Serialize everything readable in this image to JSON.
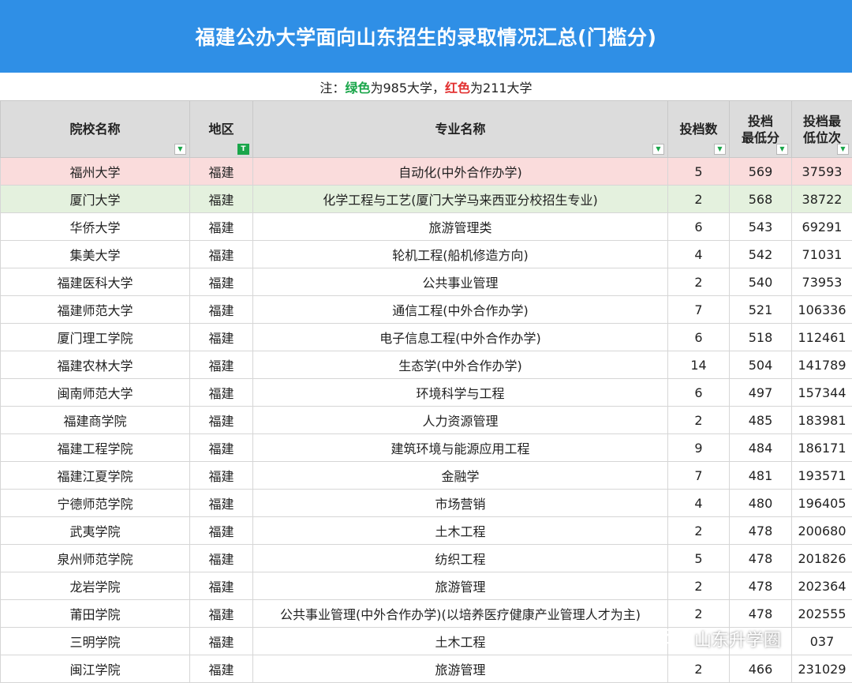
{
  "title": "福建公办大学面向山东招生的录取情况汇总(门槛分)",
  "note": {
    "prefix": "注：",
    "green_word": "绿色",
    "green_rest": "为985大学，",
    "red_word": "红色",
    "red_rest": "为211大学"
  },
  "headers": {
    "school": "院校名称",
    "region": "地区",
    "major": "专业名称",
    "count": "投档数",
    "min_score_l1": "投档",
    "min_score_l2": "最低分",
    "min_rank_l1": "投档最",
    "min_rank_l2": "低位次"
  },
  "colors": {
    "title_bg": "#2f8fe6",
    "green": "#1aa64a",
    "red": "#e23030",
    "row_985": "#fadcdc",
    "row_211": "#e4f1de"
  },
  "rows": [
    {
      "school": "福州大学",
      "region": "福建",
      "major": "自动化(中外合作办学)",
      "count": "5",
      "score": "569",
      "rank": "37593",
      "hl": "pink"
    },
    {
      "school": "厦门大学",
      "region": "福建",
      "major": "化学工程与工艺(厦门大学马来西亚分校招生专业)",
      "count": "2",
      "score": "568",
      "rank": "38722",
      "hl": "greenrow"
    },
    {
      "school": "华侨大学",
      "region": "福建",
      "major": "旅游管理类",
      "count": "6",
      "score": "543",
      "rank": "69291",
      "hl": ""
    },
    {
      "school": "集美大学",
      "region": "福建",
      "major": "轮机工程(船机修造方向)",
      "count": "4",
      "score": "542",
      "rank": "71031",
      "hl": ""
    },
    {
      "school": "福建医科大学",
      "region": "福建",
      "major": "公共事业管理",
      "count": "2",
      "score": "540",
      "rank": "73953",
      "hl": ""
    },
    {
      "school": "福建师范大学",
      "region": "福建",
      "major": "通信工程(中外合作办学)",
      "count": "7",
      "score": "521",
      "rank": "106336",
      "hl": ""
    },
    {
      "school": "厦门理工学院",
      "region": "福建",
      "major": "电子信息工程(中外合作办学)",
      "count": "6",
      "score": "518",
      "rank": "112461",
      "hl": ""
    },
    {
      "school": "福建农林大学",
      "region": "福建",
      "major": "生态学(中外合作办学)",
      "count": "14",
      "score": "504",
      "rank": "141789",
      "hl": ""
    },
    {
      "school": "闽南师范大学",
      "region": "福建",
      "major": "环境科学与工程",
      "count": "6",
      "score": "497",
      "rank": "157344",
      "hl": ""
    },
    {
      "school": "福建商学院",
      "region": "福建",
      "major": "人力资源管理",
      "count": "2",
      "score": "485",
      "rank": "183981",
      "hl": ""
    },
    {
      "school": "福建工程学院",
      "region": "福建",
      "major": "建筑环境与能源应用工程",
      "count": "9",
      "score": "484",
      "rank": "186171",
      "hl": ""
    },
    {
      "school": "福建江夏学院",
      "region": "福建",
      "major": "金融学",
      "count": "7",
      "score": "481",
      "rank": "193571",
      "hl": ""
    },
    {
      "school": "宁德师范学院",
      "region": "福建",
      "major": "市场营销",
      "count": "4",
      "score": "480",
      "rank": "196405",
      "hl": ""
    },
    {
      "school": "武夷学院",
      "region": "福建",
      "major": "土木工程",
      "count": "2",
      "score": "478",
      "rank": "200680",
      "hl": ""
    },
    {
      "school": "泉州师范学院",
      "region": "福建",
      "major": "纺织工程",
      "count": "5",
      "score": "478",
      "rank": "201826",
      "hl": ""
    },
    {
      "school": "龙岩学院",
      "region": "福建",
      "major": "旅游管理",
      "count": "2",
      "score": "478",
      "rank": "202364",
      "hl": ""
    },
    {
      "school": "莆田学院",
      "region": "福建",
      "major": "公共事业管理(中外合作办学)(以培养医疗健康产业管理人才为主)",
      "count": "2",
      "score": "478",
      "rank": "202555",
      "hl": ""
    },
    {
      "school": "三明学院",
      "region": "福建",
      "major": "土木工程",
      "count": "",
      "score": "",
      "rank": "037",
      "hl": ""
    },
    {
      "school": "闽江学院",
      "region": "福建",
      "major": "旅游管理",
      "count": "2",
      "score": "466",
      "rank": "231029",
      "hl": ""
    }
  ],
  "watermark": {
    "text": "山东升学圈",
    "icon": "wechat-icon"
  }
}
